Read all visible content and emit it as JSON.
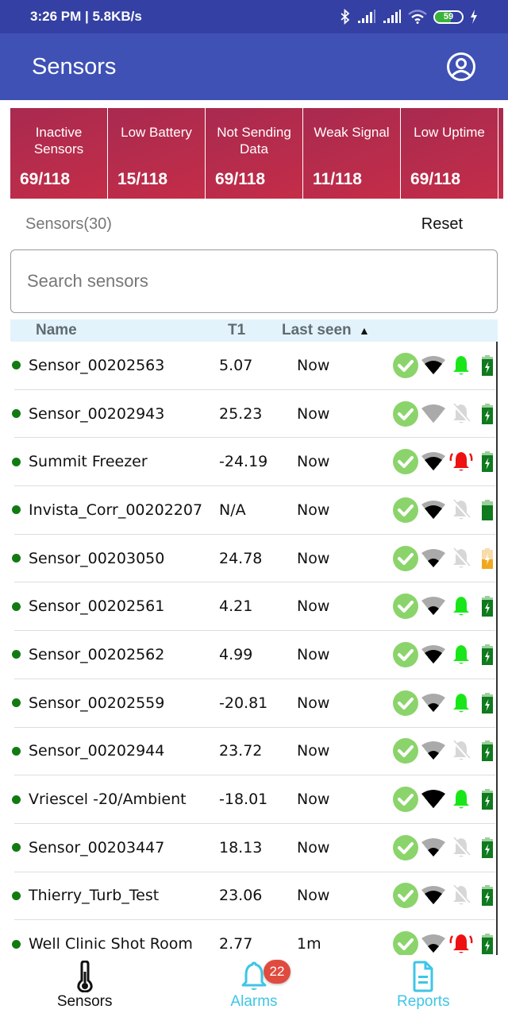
{
  "status_bar": {
    "time_speed": "3:26 PM | 5.8KB/s",
    "battery_level": "59",
    "icons": [
      "bluetooth-icon",
      "cell-signal-icon",
      "cell-signal-icon",
      "wifi-icon",
      "battery-icon",
      "charging-icon"
    ]
  },
  "app_bar": {
    "title": "Sensors",
    "account_icon": "account-circle-icon"
  },
  "summary_cards": [
    {
      "label": "Inactive Sensors",
      "value": "69/118"
    },
    {
      "label": "Low Battery",
      "value": "15/118"
    },
    {
      "label": "Not Sending Data",
      "value": "69/118"
    },
    {
      "label": "Weak Signal",
      "value": "11/118"
    },
    {
      "label": "Low Uptime",
      "value": "69/118"
    }
  ],
  "list_header": {
    "count_label": "Sensors(30)",
    "reset_label": "Reset"
  },
  "search": {
    "placeholder": "Search sensors",
    "value": ""
  },
  "table": {
    "columns": {
      "name": "Name",
      "t1": "T1",
      "last_seen": "Last seen",
      "sort_indicator": "▲"
    },
    "rows": [
      {
        "name": "Sensor_00202563",
        "t1": "5.07",
        "last_seen": "Now",
        "status": "ok",
        "signal_bars": 2,
        "alarm": "on",
        "battery": "charging"
      },
      {
        "name": "Sensor_00202943",
        "t1": "25.23",
        "last_seen": "Now",
        "status": "ok",
        "signal_bars": 0,
        "alarm": "muted",
        "battery": "charging"
      },
      {
        "name": "Summit Freezer",
        "t1": "-24.19",
        "last_seen": "Now",
        "status": "ok",
        "signal_bars": 2,
        "alarm": "ringing",
        "battery": "charging"
      },
      {
        "name": "Invista_Corr_00202207",
        "t1": "N/A",
        "last_seen": "Now",
        "status": "ok",
        "signal_bars": 2,
        "alarm": "muted",
        "battery": "full"
      },
      {
        "name": "Sensor_00203050",
        "t1": "24.78",
        "last_seen": "Now",
        "status": "ok",
        "signal_bars": 1,
        "alarm": "muted",
        "battery": "low-charging"
      },
      {
        "name": "Sensor_00202561",
        "t1": "4.21",
        "last_seen": "Now",
        "status": "ok",
        "signal_bars": 1,
        "alarm": "on",
        "battery": "charging"
      },
      {
        "name": "Sensor_00202562",
        "t1": "4.99",
        "last_seen": "Now",
        "status": "ok",
        "signal_bars": 2,
        "alarm": "on",
        "battery": "charging"
      },
      {
        "name": "Sensor_00202559",
        "t1": "-20.81",
        "last_seen": "Now",
        "status": "ok",
        "signal_bars": 1,
        "alarm": "on",
        "battery": "charging"
      },
      {
        "name": "Sensor_00202944",
        "t1": "23.72",
        "last_seen": "Now",
        "status": "ok",
        "signal_bars": 1,
        "alarm": "muted",
        "battery": "charging"
      },
      {
        "name": "Vriescel -20/Ambient",
        "t1": "-18.01",
        "last_seen": "Now",
        "status": "ok",
        "signal_bars": 3,
        "alarm": "on",
        "battery": "charging"
      },
      {
        "name": "Sensor_00203447",
        "t1": "18.13",
        "last_seen": "Now",
        "status": "ok",
        "signal_bars": 1,
        "alarm": "muted",
        "battery": "charging"
      },
      {
        "name": "Thierry_Turb_Test",
        "t1": "23.06",
        "last_seen": "Now",
        "status": "ok",
        "signal_bars": 2,
        "alarm": "muted",
        "battery": "charging"
      },
      {
        "name": "Well Clinic Shot Room",
        "t1": "2.77",
        "last_seen": "1m",
        "status": "ok",
        "signal_bars": 1,
        "alarm": "ringing",
        "battery": "charging"
      }
    ]
  },
  "bottom_nav": {
    "items": [
      {
        "label": "Sensors",
        "icon": "thermometer-icon",
        "active": true
      },
      {
        "label": "Alarms",
        "icon": "bell-icon",
        "badge": "22"
      },
      {
        "label": "Reports",
        "icon": "document-icon"
      }
    ]
  },
  "colors": {
    "status_bar": "#3440a3",
    "app_bar": "#3f51b5",
    "card_gradient_start": "#a82a50",
    "card_gradient_end": "#c42d48",
    "table_header_bg": "#e3f3fc",
    "online_dot": "#137a13",
    "check_ok": "#8bd46b",
    "alarm_on": "#19e619",
    "alarm_ringing": "#ee1111",
    "battery_green": "#0f7a1e",
    "battery_low": "#f0a821",
    "nav_accent": "#3ec6e6",
    "badge": "#e04b3f"
  }
}
